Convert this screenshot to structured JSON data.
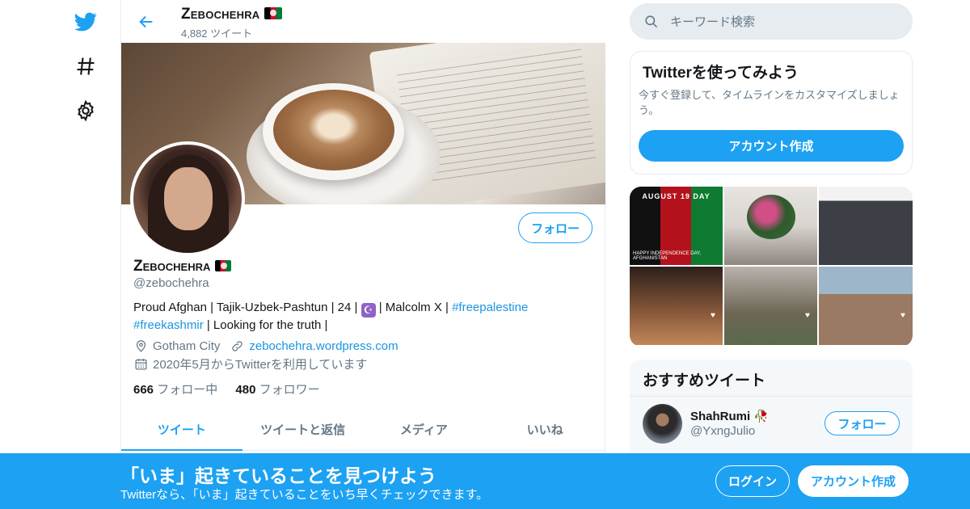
{
  "nav": {
    "icons": [
      "twitter-logo-icon",
      "hashtag-icon",
      "settings-gear-icon"
    ]
  },
  "colors": {
    "accent": "#1da1f2",
    "link": "#1b95e0",
    "secondary_text": "#657786",
    "border": "#e6ecf0"
  },
  "header": {
    "name": "Zebochehra",
    "tweet_count": "4,882 ツイート"
  },
  "profile": {
    "name": "Zebochehra",
    "handle": "@zebochehra",
    "follow_label": "フォロー",
    "bio_text_1": "Proud Afghan | Tajik-Uzbek-Pashtun | 24 | ",
    "bio_emoji": "☪",
    "bio_text_2": " | Malcolm X | ",
    "bio_link_1": "#freepalestine",
    "bio_link_2": "#freekashmir",
    "bio_text_3": " | Looking for the truth |",
    "location": "Gotham City",
    "website": "zebochehra.wordpress.com",
    "joined": "2020年5月からTwitterを利用しています",
    "following_count": "666",
    "following_label": "フォロー中",
    "followers_count": "480",
    "followers_label": "フォロワー"
  },
  "tabs": [
    {
      "label": "ツイート",
      "active": true
    },
    {
      "label": "ツイートと返信",
      "active": false
    },
    {
      "label": "メディア",
      "active": false
    },
    {
      "label": "いいね",
      "active": false
    }
  ],
  "search": {
    "placeholder": "キーワード検索"
  },
  "signup_card": {
    "title": "Twitterを使ってみよう",
    "description": "今すぐ登録して、タイムラインをカスタマイズしましょう。",
    "button": "アカウント作成"
  },
  "media": {
    "tile_1_caption": "AUGUST 19 DAY",
    "tile_1_subcaption": "HAPPY INDEPENDENCE DAY, AFGHANISTAN"
  },
  "recommended": {
    "title": "おすすめツイート",
    "user_name": "ShahRumi",
    "user_handle": "@YxngJulio",
    "follow_label": "フォロー"
  },
  "bottom_bar": {
    "title": "「いま」起きていることを見つけよう",
    "subtitle": "Twitterなら、「いま」起きていることをいち早くチェックできます。",
    "login": "ログイン",
    "signup": "アカウント作成"
  }
}
